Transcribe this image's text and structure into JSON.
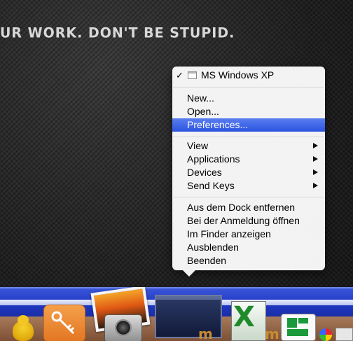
{
  "desktop": {
    "slogan": "UR WORK. DON'T BE STUPID."
  },
  "menu": {
    "vm": {
      "checked": true,
      "check_glyph": "✓",
      "icon": "vm-window-icon",
      "label": "MS Windows XP"
    },
    "group1": [
      {
        "label": "New..."
      },
      {
        "label": "Open..."
      },
      {
        "label": "Preferences...",
        "highlighted": true
      }
    ],
    "group2": [
      {
        "label": "View",
        "submenu": true
      },
      {
        "label": "Applications",
        "submenu": true
      },
      {
        "label": "Devices",
        "submenu": true
      },
      {
        "label": "Send Keys",
        "submenu": true
      }
    ],
    "group3": [
      {
        "label": "Aus dem Dock entfernen"
      },
      {
        "label": "Bei der Anmeldung öffnen"
      },
      {
        "label": "Im Finder anzeigen"
      },
      {
        "label": "Ausblenden"
      },
      {
        "label": "Beenden"
      }
    ],
    "highlight_color": "#2a53e0"
  },
  "dock": {
    "icons": [
      {
        "name": "duck-icon"
      },
      {
        "name": "keychain-icon"
      },
      {
        "name": "iphoto-icon"
      },
      {
        "name": "vm-window-icon"
      },
      {
        "name": "vmware-fusion-icon"
      },
      {
        "name": "excel-icon",
        "glyph": "X"
      },
      {
        "name": "vmware-fusion-icon-2"
      },
      {
        "name": "green-app-icon"
      },
      {
        "name": "swirl-icon"
      },
      {
        "name": "spreadsheet-icon"
      }
    ],
    "fusion_glyph": "m",
    "bar_color": "#2038c4"
  }
}
